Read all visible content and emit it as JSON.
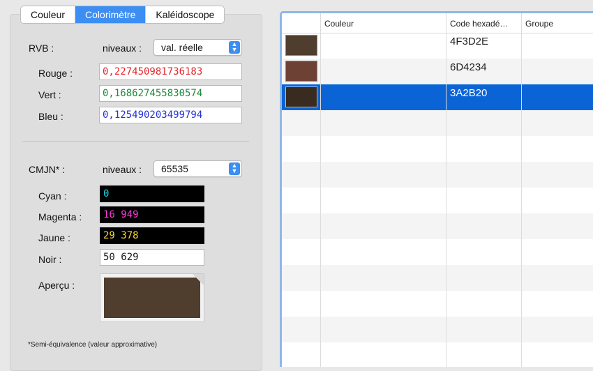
{
  "tabs": [
    {
      "label": "Couleur",
      "active": false
    },
    {
      "label": "Colorimètre",
      "active": true
    },
    {
      "label": "Kaléidoscope",
      "active": false
    }
  ],
  "rgb": {
    "label": "RVB :",
    "levels_label": "niveaux :",
    "levels_value": "val. réelle",
    "red_label": "Rouge :",
    "red_value": "0,227450981736183",
    "red_color": "#e8242a",
    "green_label": "Vert :",
    "green_value": "0,168627455830574",
    "green_color": "#1e8a3c",
    "blue_label": "Bleu :",
    "blue_value": "0,125490203499794",
    "blue_color": "#2233d8"
  },
  "cmyk": {
    "label": "CMJN* :",
    "levels_label": "niveaux :",
    "levels_value": "65535",
    "cyan_label": "Cyan :",
    "cyan_value": "0",
    "cyan_color": "#1fd6e6",
    "magenta_label": "Magenta :",
    "magenta_value": "16 949",
    "magenta_color": "#ff3bd6",
    "yellow_label": "Jaune :",
    "yellow_value": "29 378",
    "yellow_color": "#ffd82a",
    "black_label": "Noir :",
    "black_value": "50 629"
  },
  "preview": {
    "label": "Aperçu :",
    "color": "#4F3D2E"
  },
  "footnote": "*Semi-équivalence (valeur approximative)",
  "table": {
    "headers": [
      "Couleur",
      "Code hexadé…",
      "Groupe"
    ],
    "rows": [
      {
        "hex": "4F3D2E",
        "color": "#4F3D2E",
        "selected": false
      },
      {
        "hex": "6D4234",
        "color": "#6D4234",
        "selected": false
      },
      {
        "hex": "3A2B20",
        "color": "#3A2B20",
        "selected": true
      }
    ]
  }
}
